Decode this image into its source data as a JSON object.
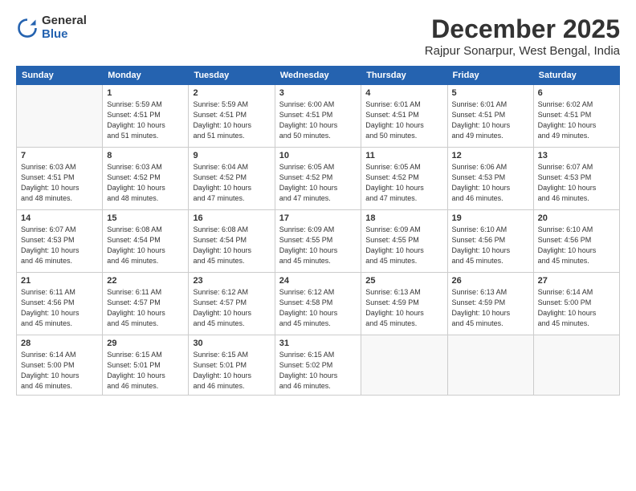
{
  "logo": {
    "general": "General",
    "blue": "Blue"
  },
  "title": "December 2025",
  "subtitle": "Rajpur Sonarpur, West Bengal, India",
  "weekdays": [
    "Sunday",
    "Monday",
    "Tuesday",
    "Wednesday",
    "Thursday",
    "Friday",
    "Saturday"
  ],
  "weeks": [
    [
      {
        "day": "",
        "info": ""
      },
      {
        "day": "1",
        "info": "Sunrise: 5:59 AM\nSunset: 4:51 PM\nDaylight: 10 hours\nand 51 minutes."
      },
      {
        "day": "2",
        "info": "Sunrise: 5:59 AM\nSunset: 4:51 PM\nDaylight: 10 hours\nand 51 minutes."
      },
      {
        "day": "3",
        "info": "Sunrise: 6:00 AM\nSunset: 4:51 PM\nDaylight: 10 hours\nand 50 minutes."
      },
      {
        "day": "4",
        "info": "Sunrise: 6:01 AM\nSunset: 4:51 PM\nDaylight: 10 hours\nand 50 minutes."
      },
      {
        "day": "5",
        "info": "Sunrise: 6:01 AM\nSunset: 4:51 PM\nDaylight: 10 hours\nand 49 minutes."
      },
      {
        "day": "6",
        "info": "Sunrise: 6:02 AM\nSunset: 4:51 PM\nDaylight: 10 hours\nand 49 minutes."
      }
    ],
    [
      {
        "day": "7",
        "info": "Sunrise: 6:03 AM\nSunset: 4:51 PM\nDaylight: 10 hours\nand 48 minutes."
      },
      {
        "day": "8",
        "info": "Sunrise: 6:03 AM\nSunset: 4:52 PM\nDaylight: 10 hours\nand 48 minutes."
      },
      {
        "day": "9",
        "info": "Sunrise: 6:04 AM\nSunset: 4:52 PM\nDaylight: 10 hours\nand 47 minutes."
      },
      {
        "day": "10",
        "info": "Sunrise: 6:05 AM\nSunset: 4:52 PM\nDaylight: 10 hours\nand 47 minutes."
      },
      {
        "day": "11",
        "info": "Sunrise: 6:05 AM\nSunset: 4:52 PM\nDaylight: 10 hours\nand 47 minutes."
      },
      {
        "day": "12",
        "info": "Sunrise: 6:06 AM\nSunset: 4:53 PM\nDaylight: 10 hours\nand 46 minutes."
      },
      {
        "day": "13",
        "info": "Sunrise: 6:07 AM\nSunset: 4:53 PM\nDaylight: 10 hours\nand 46 minutes."
      }
    ],
    [
      {
        "day": "14",
        "info": "Sunrise: 6:07 AM\nSunset: 4:53 PM\nDaylight: 10 hours\nand 46 minutes."
      },
      {
        "day": "15",
        "info": "Sunrise: 6:08 AM\nSunset: 4:54 PM\nDaylight: 10 hours\nand 46 minutes."
      },
      {
        "day": "16",
        "info": "Sunrise: 6:08 AM\nSunset: 4:54 PM\nDaylight: 10 hours\nand 45 minutes."
      },
      {
        "day": "17",
        "info": "Sunrise: 6:09 AM\nSunset: 4:55 PM\nDaylight: 10 hours\nand 45 minutes."
      },
      {
        "day": "18",
        "info": "Sunrise: 6:09 AM\nSunset: 4:55 PM\nDaylight: 10 hours\nand 45 minutes."
      },
      {
        "day": "19",
        "info": "Sunrise: 6:10 AM\nSunset: 4:56 PM\nDaylight: 10 hours\nand 45 minutes."
      },
      {
        "day": "20",
        "info": "Sunrise: 6:10 AM\nSunset: 4:56 PM\nDaylight: 10 hours\nand 45 minutes."
      }
    ],
    [
      {
        "day": "21",
        "info": "Sunrise: 6:11 AM\nSunset: 4:56 PM\nDaylight: 10 hours\nand 45 minutes."
      },
      {
        "day": "22",
        "info": "Sunrise: 6:11 AM\nSunset: 4:57 PM\nDaylight: 10 hours\nand 45 minutes."
      },
      {
        "day": "23",
        "info": "Sunrise: 6:12 AM\nSunset: 4:57 PM\nDaylight: 10 hours\nand 45 minutes."
      },
      {
        "day": "24",
        "info": "Sunrise: 6:12 AM\nSunset: 4:58 PM\nDaylight: 10 hours\nand 45 minutes."
      },
      {
        "day": "25",
        "info": "Sunrise: 6:13 AM\nSunset: 4:59 PM\nDaylight: 10 hours\nand 45 minutes."
      },
      {
        "day": "26",
        "info": "Sunrise: 6:13 AM\nSunset: 4:59 PM\nDaylight: 10 hours\nand 45 minutes."
      },
      {
        "day": "27",
        "info": "Sunrise: 6:14 AM\nSunset: 5:00 PM\nDaylight: 10 hours\nand 45 minutes."
      }
    ],
    [
      {
        "day": "28",
        "info": "Sunrise: 6:14 AM\nSunset: 5:00 PM\nDaylight: 10 hours\nand 46 minutes."
      },
      {
        "day": "29",
        "info": "Sunrise: 6:15 AM\nSunset: 5:01 PM\nDaylight: 10 hours\nand 46 minutes."
      },
      {
        "day": "30",
        "info": "Sunrise: 6:15 AM\nSunset: 5:01 PM\nDaylight: 10 hours\nand 46 minutes."
      },
      {
        "day": "31",
        "info": "Sunrise: 6:15 AM\nSunset: 5:02 PM\nDaylight: 10 hours\nand 46 minutes."
      },
      {
        "day": "",
        "info": ""
      },
      {
        "day": "",
        "info": ""
      },
      {
        "day": "",
        "info": ""
      }
    ]
  ]
}
